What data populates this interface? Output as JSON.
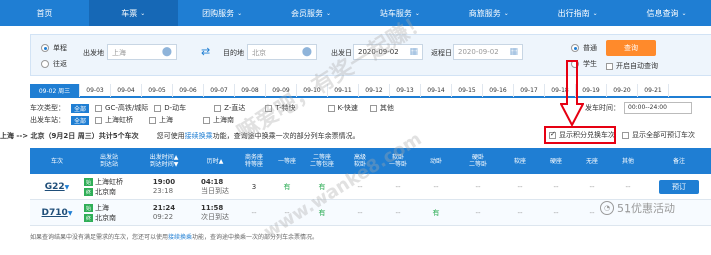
{
  "nav": {
    "items": [
      {
        "label": "首页",
        "chevron": false,
        "active": false
      },
      {
        "label": "车票",
        "chevron": true,
        "active": true
      },
      {
        "label": "团购服务",
        "chevron": true,
        "active": false
      },
      {
        "label": "会员服务",
        "chevron": true,
        "active": false
      },
      {
        "label": "站车服务",
        "chevron": true,
        "active": false
      },
      {
        "label": "商旅服务",
        "chevron": true,
        "active": false
      },
      {
        "label": "出行指南",
        "chevron": true,
        "active": false
      },
      {
        "label": "信息查询",
        "chevron": true,
        "active": false
      }
    ]
  },
  "search": {
    "trip_type": {
      "oneway": "单程",
      "roundtrip": "往返",
      "selected": "oneway"
    },
    "from_label": "出发地",
    "from_value": "上海",
    "to_label": "目的地",
    "to_value": "北京",
    "depart_label": "出发日",
    "depart_value": "2020-09-02",
    "return_label": "返程日",
    "return_value": "2020-09-02",
    "passenger": {
      "normal": "普通",
      "student": "学生",
      "selected": "normal"
    },
    "query_button": "查询",
    "auto_query_label": "开启自动查询"
  },
  "dates": {
    "active": "09-02 周三",
    "others": [
      "09-03",
      "09-04",
      "09-05",
      "09-06",
      "09-07",
      "09-08",
      "09-09",
      "09-10",
      "09-11",
      "09-12",
      "09-13",
      "09-14",
      "09-15",
      "09-16",
      "09-17",
      "09-18",
      "09-19",
      "09-20",
      "09-21"
    ]
  },
  "filters": {
    "train_type_label": "车次类型：",
    "all_chip": "全部",
    "train_types": [
      "GC-高铁/城际",
      "D-动车",
      "Z-直达",
      "T-特快",
      "K-快速",
      "其他"
    ],
    "station_label": "出发车站：",
    "stations": [
      "上海虹桥",
      "上海",
      "上海南"
    ],
    "depart_time_label": "发车时间：",
    "depart_time_value": "00:00--24:00"
  },
  "info": {
    "route": "上海 --> 北京（9月2日 周三）共计5个车次",
    "hint_prefix": "您可使用",
    "hint_link": "接续换乘",
    "hint_suffix": "功能，查询途中换乘一次的部分列车余票情况。",
    "points_check": "显示积分兑换车次",
    "all_check": "显示全部可预订车次"
  },
  "table": {
    "headers": [
      "车次",
      "出发站\n到达站",
      "出发时间▲\n到达时间▼",
      "历时▲",
      "商务座\n特等座",
      "一等座",
      "二等座\n二等包座",
      "高级\n软卧",
      "软卧\n一等卧",
      "动卧",
      "硬卧\n二等卧",
      "软座",
      "硬座",
      "无座",
      "其他",
      "备注"
    ],
    "rows": [
      {
        "train": "G22",
        "from": "上海虹桥",
        "to": "北京南",
        "dep": "19:00",
        "arr": "23:18",
        "dur": "04:18",
        "dur_note": "当日到达",
        "seats": [
          "3",
          "有",
          "有",
          "--",
          "--",
          "--",
          "--",
          "--",
          "--",
          "--",
          "--"
        ],
        "action": "预订"
      },
      {
        "train": "D710",
        "from": "上海",
        "to": "北京南",
        "dep": "21:24",
        "arr": "09:22",
        "dur": "11:58",
        "dur_note": "次日到达",
        "seats": [
          "--",
          "--",
          "有",
          "--",
          "--",
          "有",
          "--",
          "--",
          "--",
          "--",
          "--"
        ],
        "action": ""
      }
    ]
  },
  "footer_note": {
    "prefix": "如果查询结果中没有满足需求的车次，您还可以使用",
    "link": "接续换乘",
    "suffix": "功能，查询途中换乘一次的部分列车余票情况。"
  },
  "watermark": {
    "text1": "嘛爱吧，有奖一起赚！",
    "text2": "www.wanke8.com"
  },
  "brand": {
    "logo_text": "51优惠活动"
  },
  "colors": {
    "primary": "#1f7ed3",
    "orange": "#ff8a2b",
    "red": "#e60012",
    "green": "#2fae57"
  }
}
